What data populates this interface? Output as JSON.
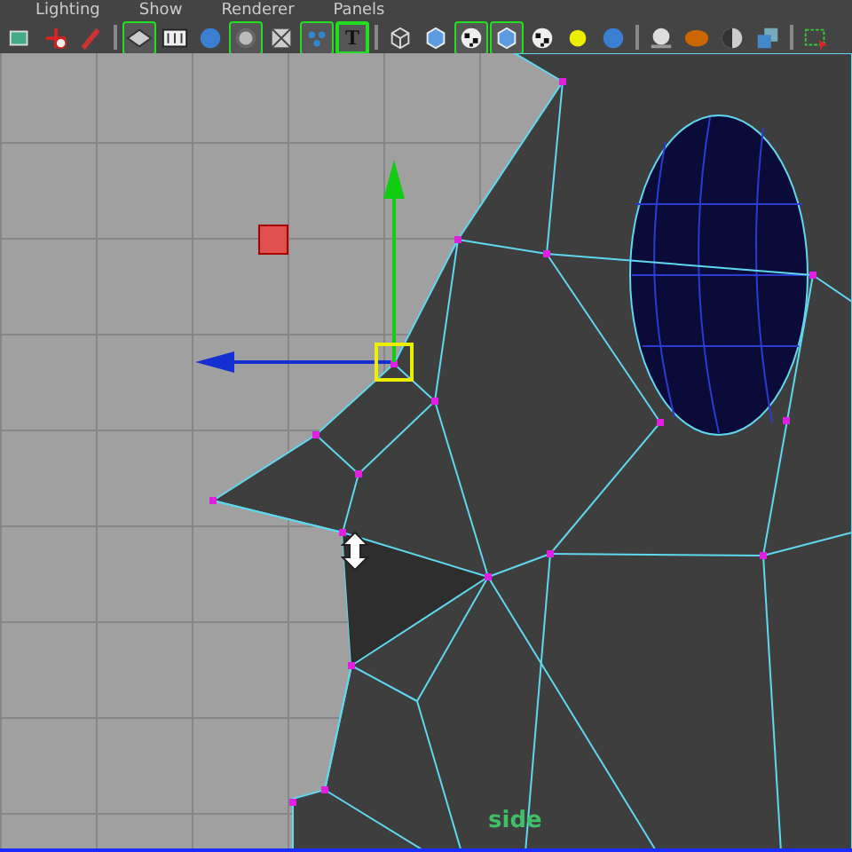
{
  "menu": [
    {
      "label": "Lighting"
    },
    {
      "label": "Show"
    },
    {
      "label": "Renderer"
    },
    {
      "label": "Panels"
    }
  ],
  "toolbar": [
    {
      "kind": "select",
      "on": false
    },
    {
      "kind": "move",
      "on": false
    },
    {
      "kind": "brush",
      "on": false
    },
    {
      "kind": "sep"
    },
    {
      "kind": "plane",
      "on": true
    },
    {
      "kind": "film",
      "on": false
    },
    {
      "kind": "ball",
      "on": false
    },
    {
      "kind": "ring",
      "on": true
    },
    {
      "kind": "grid",
      "on": false
    },
    {
      "kind": "dots",
      "on": true
    },
    {
      "kind": "text",
      "on": true,
      "glyph": "T"
    },
    {
      "kind": "sep"
    },
    {
      "kind": "wirecube",
      "on": false
    },
    {
      "kind": "cube",
      "on": false
    },
    {
      "kind": "checker",
      "on": true
    },
    {
      "kind": "cube",
      "on": true
    },
    {
      "kind": "checker",
      "on": false
    },
    {
      "kind": "light",
      "on": false
    },
    {
      "kind": "ball",
      "on": false
    },
    {
      "kind": "sep"
    },
    {
      "kind": "shade",
      "on": false
    },
    {
      "kind": "ellipsoid",
      "on": false
    },
    {
      "kind": "half",
      "on": false
    },
    {
      "kind": "cubes",
      "on": false
    },
    {
      "kind": "sep"
    },
    {
      "kind": "marquee",
      "on": false
    }
  ],
  "viewport": {
    "label": "side",
    "active": true
  }
}
